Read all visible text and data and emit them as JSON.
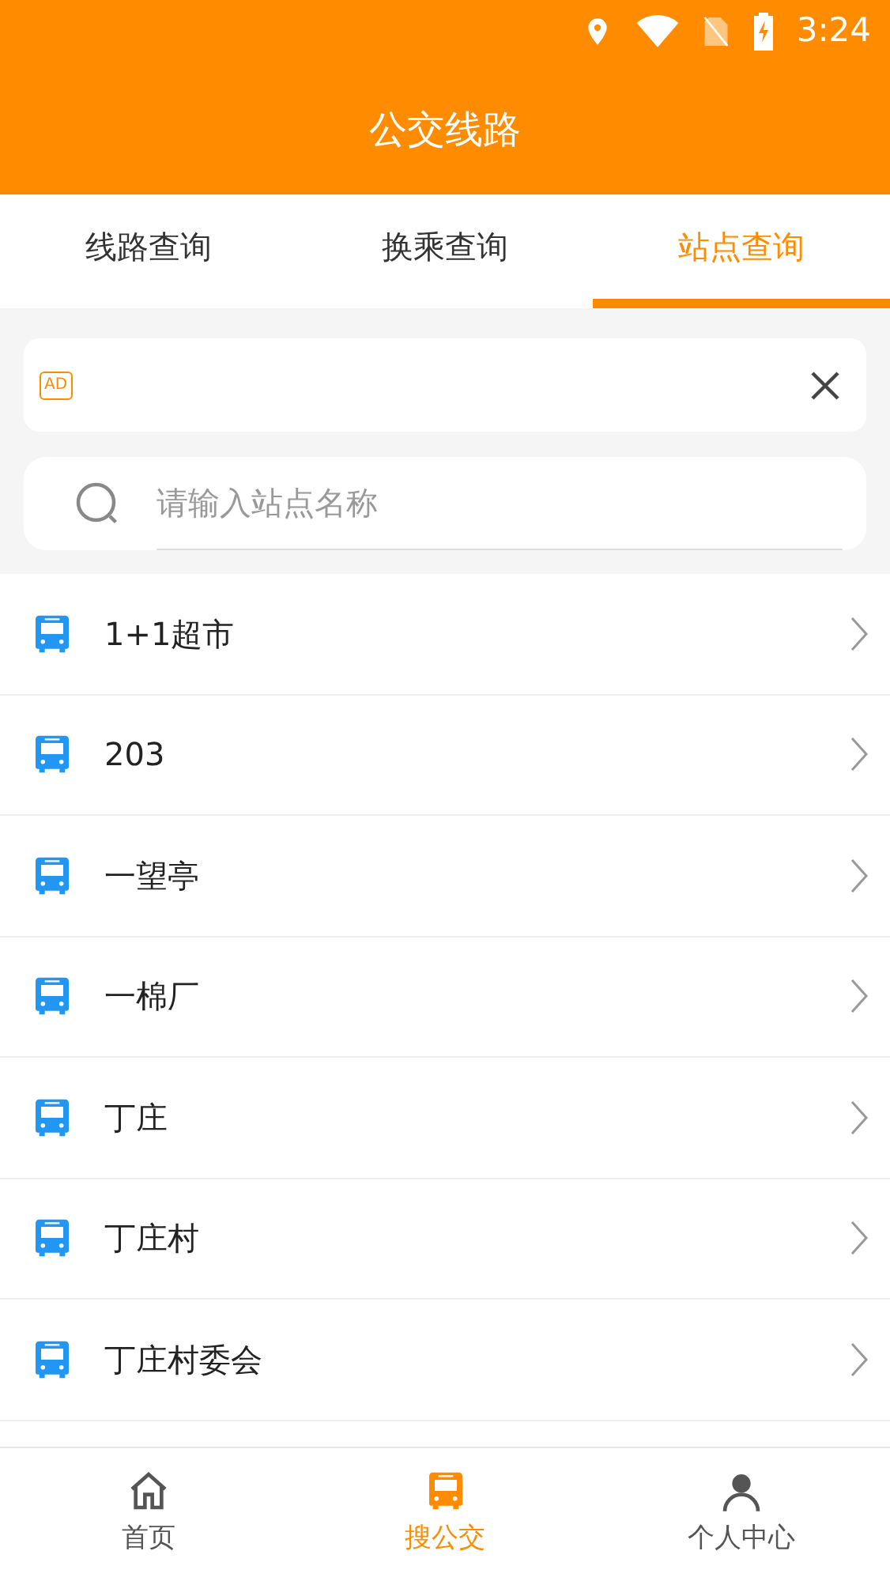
{
  "status_bar": {
    "time": "3:24"
  },
  "header": {
    "title": "公交线路"
  },
  "tabs": [
    {
      "label": "线路查询",
      "selected": false
    },
    {
      "label": "换乘查询",
      "selected": false
    },
    {
      "label": "站点查询",
      "selected": true
    }
  ],
  "ad": {
    "badge": "AD"
  },
  "search": {
    "placeholder": "请输入站点名称"
  },
  "stations": [
    {
      "name": "1+1超市"
    },
    {
      "name": "203"
    },
    {
      "name": "一望亭"
    },
    {
      "name": "一棉厂"
    },
    {
      "name": "丁庄"
    },
    {
      "name": "丁庄村"
    },
    {
      "name": "丁庄村委会"
    }
  ],
  "bottom_nav": [
    {
      "label": "首页",
      "kind": "home",
      "selected": false
    },
    {
      "label": "搜公交",
      "kind": "bus",
      "selected": true
    },
    {
      "label": "个人中心",
      "kind": "person",
      "selected": false
    }
  ]
}
